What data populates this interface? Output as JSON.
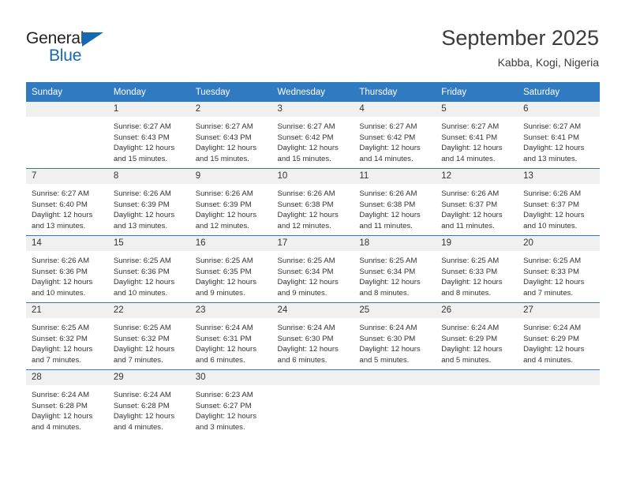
{
  "brand": {
    "name_part1": "General",
    "name_part2": "Blue",
    "accent_color": "#1668b3"
  },
  "header": {
    "title": "September 2025",
    "subtitle": "Kabba, Kogi, Nigeria"
  },
  "theme": {
    "header_row_color": "#2f7ac0",
    "daynum_band_color": "#f0f0f0",
    "separator_color": "#2f7ac0",
    "text_color": "#333333"
  },
  "weekday_headers": [
    "Sunday",
    "Monday",
    "Tuesday",
    "Wednesday",
    "Thursday",
    "Friday",
    "Saturday"
  ],
  "labels": {
    "sunrise_prefix": "Sunrise:",
    "sunset_prefix": "Sunset:",
    "daylight_prefix": "Daylight:"
  },
  "weeks": [
    [
      {
        "day": "",
        "empty": true
      },
      {
        "day": "1",
        "sunrise": "Sunrise: 6:27 AM",
        "sunset": "Sunset: 6:43 PM",
        "daylight_l1": "Daylight: 12 hours",
        "daylight_l2": "and 15 minutes."
      },
      {
        "day": "2",
        "sunrise": "Sunrise: 6:27 AM",
        "sunset": "Sunset: 6:43 PM",
        "daylight_l1": "Daylight: 12 hours",
        "daylight_l2": "and 15 minutes."
      },
      {
        "day": "3",
        "sunrise": "Sunrise: 6:27 AM",
        "sunset": "Sunset: 6:42 PM",
        "daylight_l1": "Daylight: 12 hours",
        "daylight_l2": "and 15 minutes."
      },
      {
        "day": "4",
        "sunrise": "Sunrise: 6:27 AM",
        "sunset": "Sunset: 6:42 PM",
        "daylight_l1": "Daylight: 12 hours",
        "daylight_l2": "and 14 minutes."
      },
      {
        "day": "5",
        "sunrise": "Sunrise: 6:27 AM",
        "sunset": "Sunset: 6:41 PM",
        "daylight_l1": "Daylight: 12 hours",
        "daylight_l2": "and 14 minutes."
      },
      {
        "day": "6",
        "sunrise": "Sunrise: 6:27 AM",
        "sunset": "Sunset: 6:41 PM",
        "daylight_l1": "Daylight: 12 hours",
        "daylight_l2": "and 13 minutes."
      }
    ],
    [
      {
        "day": "7",
        "sunrise": "Sunrise: 6:27 AM",
        "sunset": "Sunset: 6:40 PM",
        "daylight_l1": "Daylight: 12 hours",
        "daylight_l2": "and 13 minutes."
      },
      {
        "day": "8",
        "sunrise": "Sunrise: 6:26 AM",
        "sunset": "Sunset: 6:39 PM",
        "daylight_l1": "Daylight: 12 hours",
        "daylight_l2": "and 13 minutes."
      },
      {
        "day": "9",
        "sunrise": "Sunrise: 6:26 AM",
        "sunset": "Sunset: 6:39 PM",
        "daylight_l1": "Daylight: 12 hours",
        "daylight_l2": "and 12 minutes."
      },
      {
        "day": "10",
        "sunrise": "Sunrise: 6:26 AM",
        "sunset": "Sunset: 6:38 PM",
        "daylight_l1": "Daylight: 12 hours",
        "daylight_l2": "and 12 minutes."
      },
      {
        "day": "11",
        "sunrise": "Sunrise: 6:26 AM",
        "sunset": "Sunset: 6:38 PM",
        "daylight_l1": "Daylight: 12 hours",
        "daylight_l2": "and 11 minutes."
      },
      {
        "day": "12",
        "sunrise": "Sunrise: 6:26 AM",
        "sunset": "Sunset: 6:37 PM",
        "daylight_l1": "Daylight: 12 hours",
        "daylight_l2": "and 11 minutes."
      },
      {
        "day": "13",
        "sunrise": "Sunrise: 6:26 AM",
        "sunset": "Sunset: 6:37 PM",
        "daylight_l1": "Daylight: 12 hours",
        "daylight_l2": "and 10 minutes."
      }
    ],
    [
      {
        "day": "14",
        "sunrise": "Sunrise: 6:26 AM",
        "sunset": "Sunset: 6:36 PM",
        "daylight_l1": "Daylight: 12 hours",
        "daylight_l2": "and 10 minutes."
      },
      {
        "day": "15",
        "sunrise": "Sunrise: 6:25 AM",
        "sunset": "Sunset: 6:36 PM",
        "daylight_l1": "Daylight: 12 hours",
        "daylight_l2": "and 10 minutes."
      },
      {
        "day": "16",
        "sunrise": "Sunrise: 6:25 AM",
        "sunset": "Sunset: 6:35 PM",
        "daylight_l1": "Daylight: 12 hours",
        "daylight_l2": "and 9 minutes."
      },
      {
        "day": "17",
        "sunrise": "Sunrise: 6:25 AM",
        "sunset": "Sunset: 6:34 PM",
        "daylight_l1": "Daylight: 12 hours",
        "daylight_l2": "and 9 minutes."
      },
      {
        "day": "18",
        "sunrise": "Sunrise: 6:25 AM",
        "sunset": "Sunset: 6:34 PM",
        "daylight_l1": "Daylight: 12 hours",
        "daylight_l2": "and 8 minutes."
      },
      {
        "day": "19",
        "sunrise": "Sunrise: 6:25 AM",
        "sunset": "Sunset: 6:33 PM",
        "daylight_l1": "Daylight: 12 hours",
        "daylight_l2": "and 8 minutes."
      },
      {
        "day": "20",
        "sunrise": "Sunrise: 6:25 AM",
        "sunset": "Sunset: 6:33 PM",
        "daylight_l1": "Daylight: 12 hours",
        "daylight_l2": "and 7 minutes."
      }
    ],
    [
      {
        "day": "21",
        "sunrise": "Sunrise: 6:25 AM",
        "sunset": "Sunset: 6:32 PM",
        "daylight_l1": "Daylight: 12 hours",
        "daylight_l2": "and 7 minutes."
      },
      {
        "day": "22",
        "sunrise": "Sunrise: 6:25 AM",
        "sunset": "Sunset: 6:32 PM",
        "daylight_l1": "Daylight: 12 hours",
        "daylight_l2": "and 7 minutes."
      },
      {
        "day": "23",
        "sunrise": "Sunrise: 6:24 AM",
        "sunset": "Sunset: 6:31 PM",
        "daylight_l1": "Daylight: 12 hours",
        "daylight_l2": "and 6 minutes."
      },
      {
        "day": "24",
        "sunrise": "Sunrise: 6:24 AM",
        "sunset": "Sunset: 6:30 PM",
        "daylight_l1": "Daylight: 12 hours",
        "daylight_l2": "and 6 minutes."
      },
      {
        "day": "25",
        "sunrise": "Sunrise: 6:24 AM",
        "sunset": "Sunset: 6:30 PM",
        "daylight_l1": "Daylight: 12 hours",
        "daylight_l2": "and 5 minutes."
      },
      {
        "day": "26",
        "sunrise": "Sunrise: 6:24 AM",
        "sunset": "Sunset: 6:29 PM",
        "daylight_l1": "Daylight: 12 hours",
        "daylight_l2": "and 5 minutes."
      },
      {
        "day": "27",
        "sunrise": "Sunrise: 6:24 AM",
        "sunset": "Sunset: 6:29 PM",
        "daylight_l1": "Daylight: 12 hours",
        "daylight_l2": "and 4 minutes."
      }
    ],
    [
      {
        "day": "28",
        "sunrise": "Sunrise: 6:24 AM",
        "sunset": "Sunset: 6:28 PM",
        "daylight_l1": "Daylight: 12 hours",
        "daylight_l2": "and 4 minutes."
      },
      {
        "day": "29",
        "sunrise": "Sunrise: 6:24 AM",
        "sunset": "Sunset: 6:28 PM",
        "daylight_l1": "Daylight: 12 hours",
        "daylight_l2": "and 4 minutes."
      },
      {
        "day": "30",
        "sunrise": "Sunrise: 6:23 AM",
        "sunset": "Sunset: 6:27 PM",
        "daylight_l1": "Daylight: 12 hours",
        "daylight_l2": "and 3 minutes."
      },
      {
        "day": "",
        "empty": true
      },
      {
        "day": "",
        "empty": true
      },
      {
        "day": "",
        "empty": true
      },
      {
        "day": "",
        "empty": true
      }
    ]
  ]
}
